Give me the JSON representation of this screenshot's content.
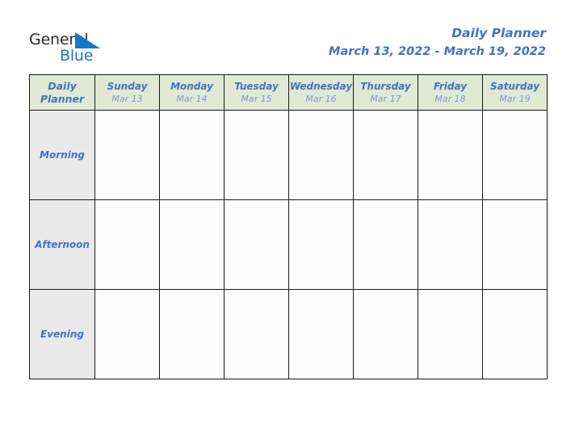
{
  "brand": {
    "name_top": "General",
    "name_bottom": "Blue",
    "triangle_icon": "triangle-icon",
    "top_color": "#2b2b2b",
    "bottom_color": "#1878c8"
  },
  "header": {
    "title": "Daily Planner",
    "date_range": "March 13, 2022 - March 19, 2022",
    "title_color": "#4372c4"
  },
  "table": {
    "corner": {
      "line1": "Daily",
      "line2": "Planner"
    },
    "header_bg": "#dfe9d3",
    "label_bg": "#eaeaea",
    "border_color": "#1a1a1a",
    "days": [
      {
        "name": "Sunday",
        "date": "Mar 13"
      },
      {
        "name": "Monday",
        "date": "Mar 14"
      },
      {
        "name": "Tuesday",
        "date": "Mar 15"
      },
      {
        "name": "Wednesday",
        "date": "Mar 16"
      },
      {
        "name": "Thursday",
        "date": "Mar 17"
      },
      {
        "name": "Friday",
        "date": "Mar 18"
      },
      {
        "name": "Saturday",
        "date": "Mar 19"
      }
    ],
    "rows": [
      {
        "label": "Morning",
        "cells": [
          "",
          "",
          "",
          "",
          "",
          "",
          ""
        ]
      },
      {
        "label": "Afternoon",
        "cells": [
          "",
          "",
          "",
          "",
          "",
          "",
          ""
        ]
      },
      {
        "label": "Evening",
        "cells": [
          "",
          "",
          "",
          "",
          "",
          "",
          ""
        ]
      }
    ]
  }
}
